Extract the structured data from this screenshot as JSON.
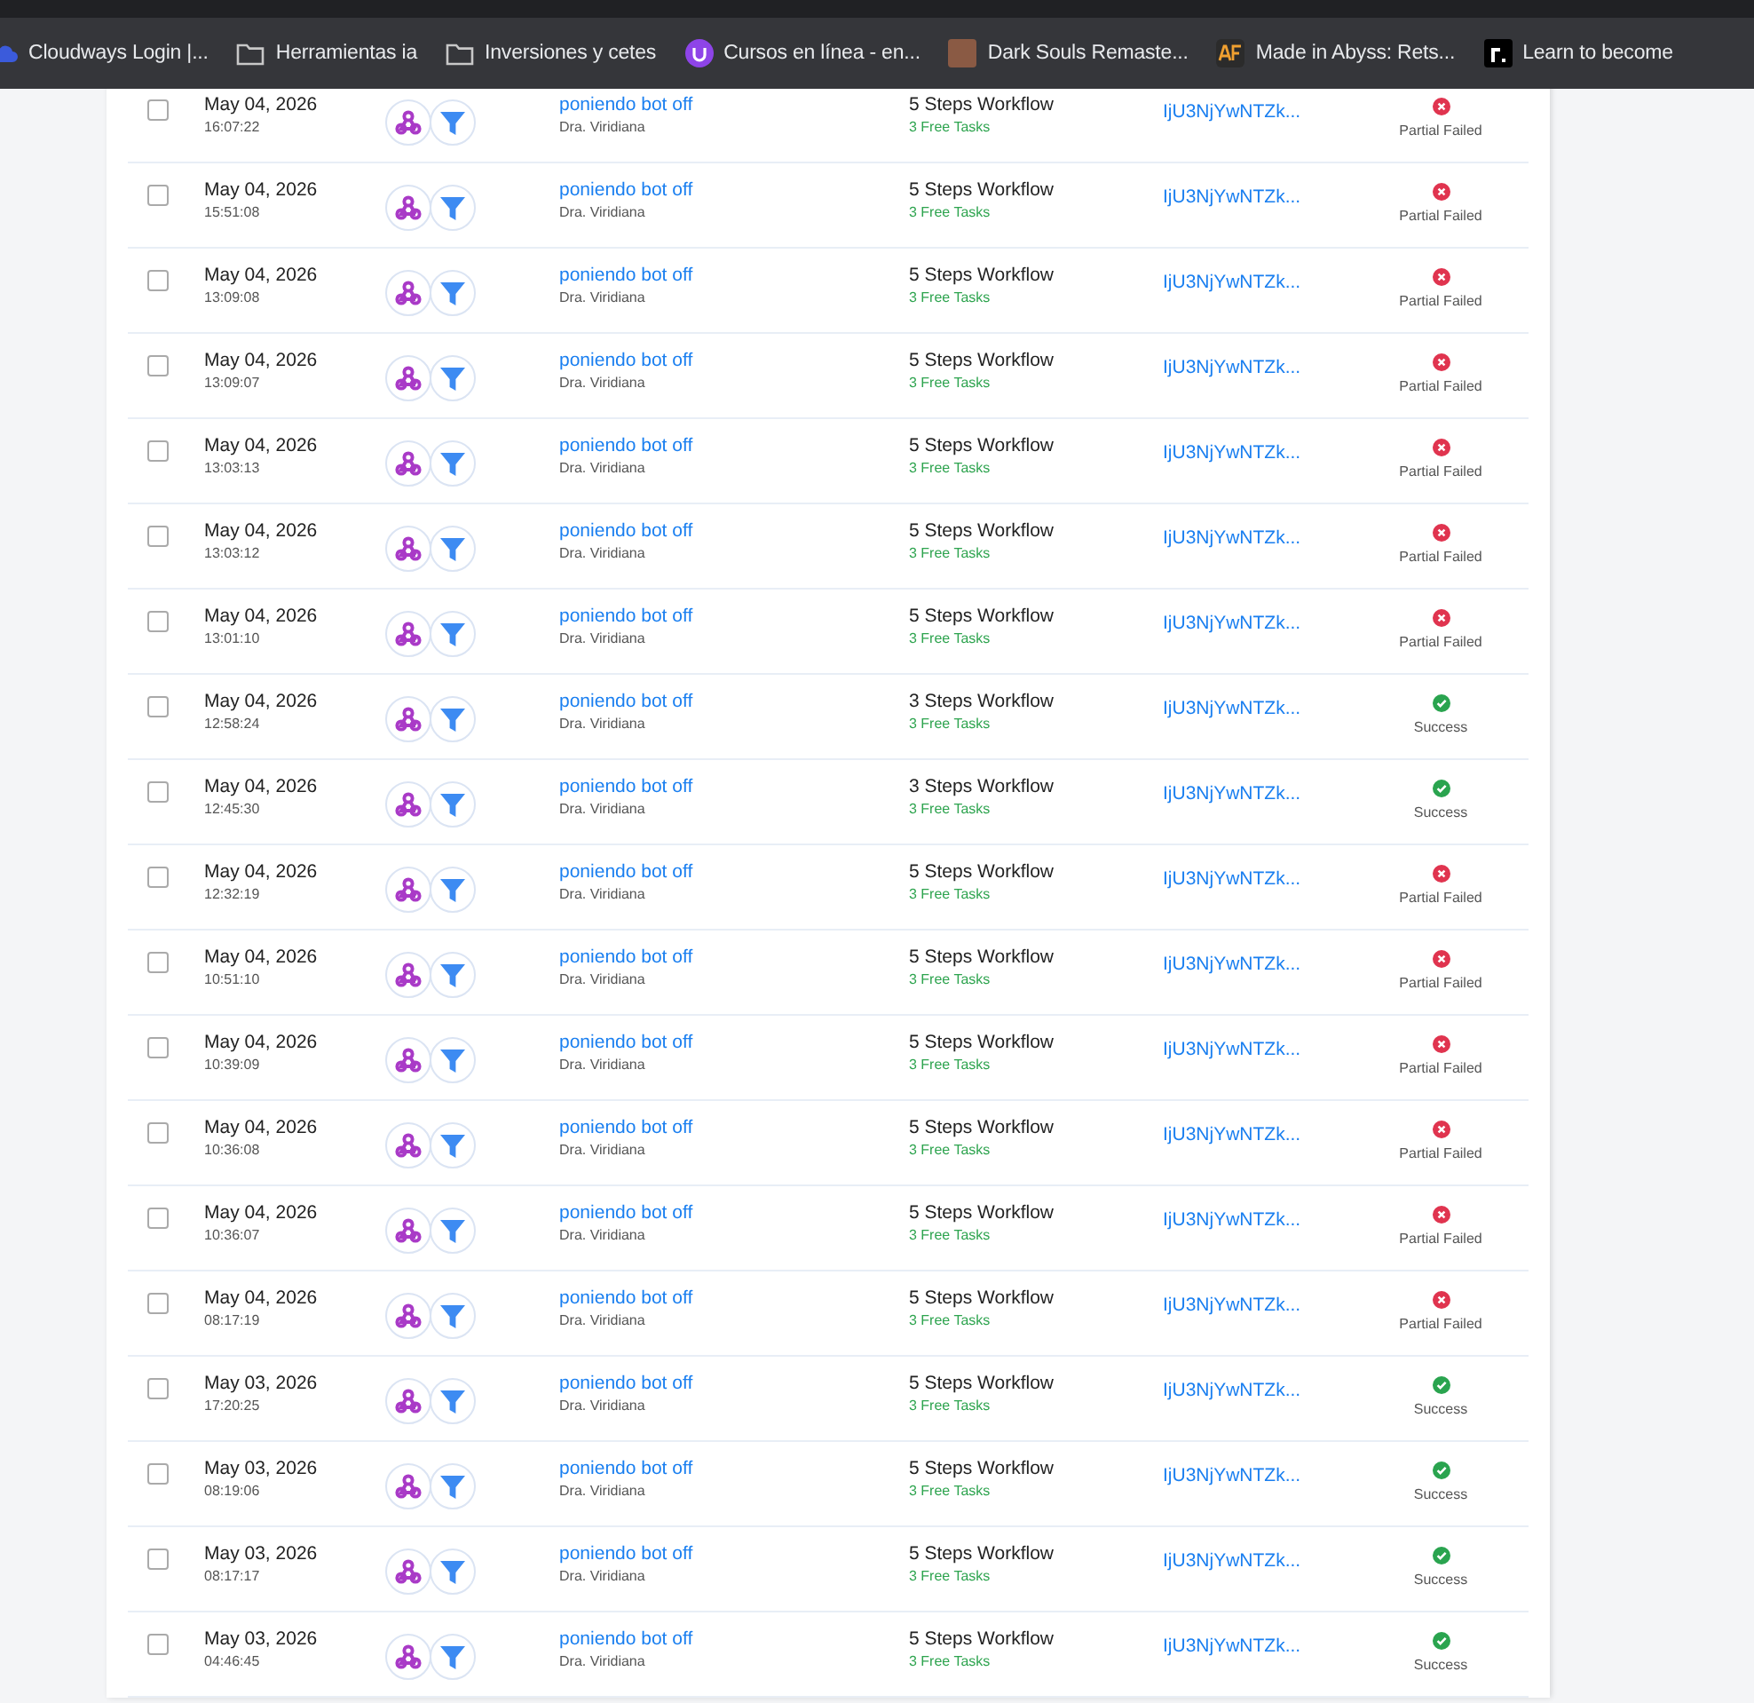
{
  "bookmarks_bar": [
    {
      "kind": "cloud",
      "label": "Cloudways Login |..."
    },
    {
      "kind": "folder",
      "label": "Herramientas ia"
    },
    {
      "kind": "folder",
      "label": "Inversiones y cetes"
    },
    {
      "kind": "u-badge",
      "label": "Cursos en línea - en..."
    },
    {
      "kind": "photo",
      "label": "Dark Souls Remaste..."
    },
    {
      "kind": "af",
      "label": "Made in Abyss: Rets..."
    },
    {
      "kind": "r-logo",
      "label": "Learn to become"
    }
  ],
  "rows": [
    {
      "checked": false,
      "date": "May 04, 2026",
      "time": "16:07:22",
      "name": "poniendo bot off",
      "owner": "Dra. Viridiana",
      "workflow": "5 Steps Workflow",
      "tasks": "3 Free Tasks",
      "id": "IjU3NjYwNTZk...",
      "status": {
        "kind": "partial_failed",
        "label": "Partial Failed"
      }
    },
    {
      "checked": false,
      "date": "May 04, 2026",
      "time": "15:51:08",
      "name": "poniendo bot off",
      "owner": "Dra. Viridiana",
      "workflow": "5 Steps Workflow",
      "tasks": "3 Free Tasks",
      "id": "IjU3NjYwNTZk...",
      "status": {
        "kind": "partial_failed",
        "label": "Partial Failed"
      }
    },
    {
      "checked": false,
      "date": "May 04, 2026",
      "time": "13:09:08",
      "name": "poniendo bot off",
      "owner": "Dra. Viridiana",
      "workflow": "5 Steps Workflow",
      "tasks": "3 Free Tasks",
      "id": "IjU3NjYwNTZk...",
      "status": {
        "kind": "partial_failed",
        "label": "Partial Failed"
      }
    },
    {
      "checked": false,
      "date": "May 04, 2026",
      "time": "13:09:07",
      "name": "poniendo bot off",
      "owner": "Dra. Viridiana",
      "workflow": "5 Steps Workflow",
      "tasks": "3 Free Tasks",
      "id": "IjU3NjYwNTZk...",
      "status": {
        "kind": "partial_failed",
        "label": "Partial Failed"
      }
    },
    {
      "checked": false,
      "date": "May 04, 2026",
      "time": "13:03:13",
      "name": "poniendo bot off",
      "owner": "Dra. Viridiana",
      "workflow": "5 Steps Workflow",
      "tasks": "3 Free Tasks",
      "id": "IjU3NjYwNTZk...",
      "status": {
        "kind": "partial_failed",
        "label": "Partial Failed"
      }
    },
    {
      "checked": false,
      "date": "May 04, 2026",
      "time": "13:03:12",
      "name": "poniendo bot off",
      "owner": "Dra. Viridiana",
      "workflow": "5 Steps Workflow",
      "tasks": "3 Free Tasks",
      "id": "IjU3NjYwNTZk...",
      "status": {
        "kind": "partial_failed",
        "label": "Partial Failed"
      }
    },
    {
      "checked": false,
      "date": "May 04, 2026",
      "time": "13:01:10",
      "name": "poniendo bot off",
      "owner": "Dra. Viridiana",
      "workflow": "5 Steps Workflow",
      "tasks": "3 Free Tasks",
      "id": "IjU3NjYwNTZk...",
      "status": {
        "kind": "partial_failed",
        "label": "Partial Failed"
      }
    },
    {
      "checked": false,
      "date": "May 04, 2026",
      "time": "12:58:24",
      "name": "poniendo bot off",
      "owner": "Dra. Viridiana",
      "workflow": "3 Steps Workflow",
      "tasks": "3 Free Tasks",
      "id": "IjU3NjYwNTZk...",
      "status": {
        "kind": "success",
        "label": "Success"
      }
    },
    {
      "checked": false,
      "date": "May 04, 2026",
      "time": "12:45:30",
      "name": "poniendo bot off",
      "owner": "Dra. Viridiana",
      "workflow": "3 Steps Workflow",
      "tasks": "3 Free Tasks",
      "id": "IjU3NjYwNTZk...",
      "status": {
        "kind": "success",
        "label": "Success"
      }
    },
    {
      "checked": false,
      "date": "May 04, 2026",
      "time": "12:32:19",
      "name": "poniendo bot off",
      "owner": "Dra. Viridiana",
      "workflow": "5 Steps Workflow",
      "tasks": "3 Free Tasks",
      "id": "IjU3NjYwNTZk...",
      "status": {
        "kind": "partial_failed",
        "label": "Partial Failed"
      }
    },
    {
      "checked": false,
      "date": "May 04, 2026",
      "time": "10:51:10",
      "name": "poniendo bot off",
      "owner": "Dra. Viridiana",
      "workflow": "5 Steps Workflow",
      "tasks": "3 Free Tasks",
      "id": "IjU3NjYwNTZk...",
      "status": {
        "kind": "partial_failed",
        "label": "Partial Failed"
      }
    },
    {
      "checked": false,
      "date": "May 04, 2026",
      "time": "10:39:09",
      "name": "poniendo bot off",
      "owner": "Dra. Viridiana",
      "workflow": "5 Steps Workflow",
      "tasks": "3 Free Tasks",
      "id": "IjU3NjYwNTZk...",
      "status": {
        "kind": "partial_failed",
        "label": "Partial Failed"
      }
    },
    {
      "checked": false,
      "date": "May 04, 2026",
      "time": "10:36:08",
      "name": "poniendo bot off",
      "owner": "Dra. Viridiana",
      "workflow": "5 Steps Workflow",
      "tasks": "3 Free Tasks",
      "id": "IjU3NjYwNTZk...",
      "status": {
        "kind": "partial_failed",
        "label": "Partial Failed"
      }
    },
    {
      "checked": false,
      "date": "May 04, 2026",
      "time": "10:36:07",
      "name": "poniendo bot off",
      "owner": "Dra. Viridiana",
      "workflow": "5 Steps Workflow",
      "tasks": "3 Free Tasks",
      "id": "IjU3NjYwNTZk...",
      "status": {
        "kind": "partial_failed",
        "label": "Partial Failed"
      }
    },
    {
      "checked": false,
      "date": "May 04, 2026",
      "time": "08:17:19",
      "name": "poniendo bot off",
      "owner": "Dra. Viridiana",
      "workflow": "5 Steps Workflow",
      "tasks": "3 Free Tasks",
      "id": "IjU3NjYwNTZk...",
      "status": {
        "kind": "partial_failed",
        "label": "Partial Failed"
      }
    },
    {
      "checked": false,
      "date": "May 03, 2026",
      "time": "17:20:25",
      "name": "poniendo bot off",
      "owner": "Dra. Viridiana",
      "workflow": "5 Steps Workflow",
      "tasks": "3 Free Tasks",
      "id": "IjU3NjYwNTZk...",
      "status": {
        "kind": "success",
        "label": "Success"
      }
    },
    {
      "checked": false,
      "date": "May 03, 2026",
      "time": "08:19:06",
      "name": "poniendo bot off",
      "owner": "Dra. Viridiana",
      "workflow": "5 Steps Workflow",
      "tasks": "3 Free Tasks",
      "id": "IjU3NjYwNTZk...",
      "status": {
        "kind": "success",
        "label": "Success"
      }
    },
    {
      "checked": false,
      "date": "May 03, 2026",
      "time": "08:17:17",
      "name": "poniendo bot off",
      "owner": "Dra. Viridiana",
      "workflow": "5 Steps Workflow",
      "tasks": "3 Free Tasks",
      "id": "IjU3NjYwNTZk...",
      "status": {
        "kind": "success",
        "label": "Success"
      }
    },
    {
      "checked": false,
      "date": "May 03, 2026",
      "time": "04:46:45",
      "name": "poniendo bot off",
      "owner": "Dra. Viridiana",
      "workflow": "5 Steps Workflow",
      "tasks": "3 Free Tasks",
      "id": "IjU3NjYwNTZk...",
      "status": {
        "kind": "success",
        "label": "Success"
      }
    }
  ]
}
